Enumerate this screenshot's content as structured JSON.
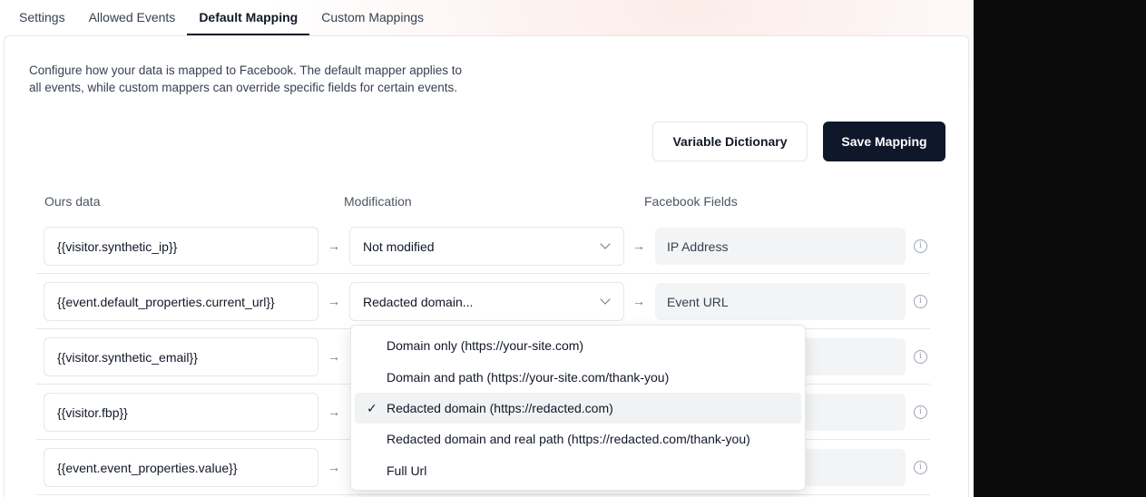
{
  "tabs": [
    {
      "label": "Settings",
      "active": false
    },
    {
      "label": "Allowed Events",
      "active": false
    },
    {
      "label": "Default Mapping",
      "active": true
    },
    {
      "label": "Custom Mappings",
      "active": false
    }
  ],
  "description": {
    "line1": "Configure how your data is mapped to Facebook. The default mapper applies to",
    "line2": "all events, while custom mappers can override specific fields for certain events."
  },
  "buttons": {
    "variable_dictionary": "Variable Dictionary",
    "save_mapping": "Save Mapping"
  },
  "columns": {
    "ours_data": "Ours data",
    "modification": "Modification",
    "facebook_fields": "Facebook Fields"
  },
  "rows": [
    {
      "ours": "{{visitor.synthetic_ip}}",
      "modification": "Not modified",
      "facebook": "IP Address"
    },
    {
      "ours": "{{event.default_properties.current_url}}",
      "modification": "Redacted domain...",
      "facebook": "Event URL"
    },
    {
      "ours": "{{visitor.synthetic_email}}",
      "modification": "",
      "facebook": ""
    },
    {
      "ours": "{{visitor.fbp}}",
      "modification": "",
      "facebook": ""
    },
    {
      "ours": "{{event.event_properties.value}}",
      "modification": "",
      "facebook": ""
    }
  ],
  "dropdown": {
    "options": [
      {
        "label": "Domain only (https://your-site.com)",
        "selected": false
      },
      {
        "label": "Domain and path (https://your-site.com/thank-you)",
        "selected": false
      },
      {
        "label": "Redacted domain (https://redacted.com)",
        "selected": true
      },
      {
        "label": "Redacted domain and real path (https://redacted.com/thank-you)",
        "selected": false
      },
      {
        "label": "Full Url",
        "selected": false
      }
    ],
    "check_glyph": "✓"
  },
  "glyphs": {
    "arrow": "→",
    "info": "i"
  },
  "icons": [
    "arrow-right-icon",
    "chevron-down-icon",
    "info-icon",
    "check-icon"
  ]
}
